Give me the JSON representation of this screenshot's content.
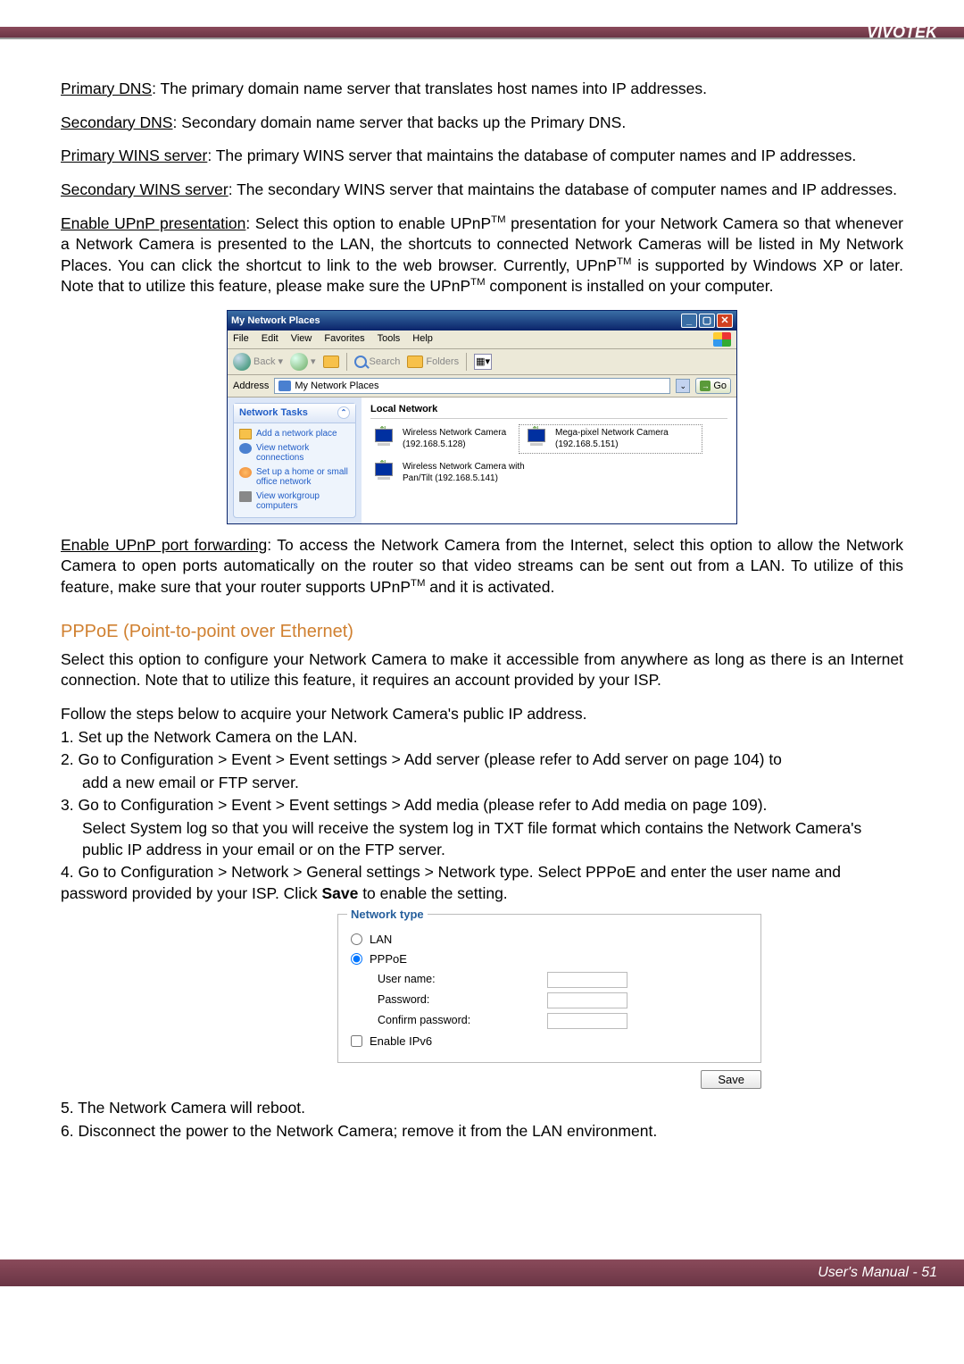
{
  "header": {
    "brand": "VIVOTEK"
  },
  "body": {
    "p1_label": "Primary DNS",
    "p1_text": ": The primary domain name server that translates host names into IP addresses.",
    "p2_label": "Secondary DNS",
    "p2_text": ": Secondary domain name server that backs up the Primary DNS.",
    "p3_label": "Primary WINS server",
    "p3_text": ": The primary WINS server that maintains the database of computer names and IP addresses.",
    "p4_label": "Secondary WINS server",
    "p4_text": ": The secondary WINS server that maintains the database of computer names and IP addresses.",
    "p5_label": "Enable UPnP presentation",
    "p5_t1": ": Select this option to enable UPnP",
    "p5_t2": " presentation for your Network Camera so that whenever a Network Camera is presented to the LAN, the shortcuts to connected Network Cameras will be listed in My Network Places. You can click the shortcut to link to the web browser. Currently, UPnP",
    "p5_t3": " is supported by Windows XP or later. Note that to utilize this feature, please make sure the UPnP",
    "p5_t4": " component is installed on your computer.",
    "p6_label": "Enable UPnP port forwarding",
    "p6_t1": ": To access the Network Camera from the Internet, select this option to allow the Network Camera to open ports automatically on the router so that video streams can be sent out from a LAN. To utilize of this feature, make sure that your router supports UPnP",
    "p6_t2": " and it is activated.",
    "section_title": "PPPoE (Point-to-point over Ethernet)",
    "pppoe_intro": "Select this option to configure your Network Camera to make it accessible from anywhere as long as there is an Internet connection. Note that to utilize this feature, it requires an account provided by your ISP.",
    "steps_intro": "Follow the steps below to acquire your Network Camera's public IP address.",
    "step1": "1. Set up the Network Camera on the LAN.",
    "step2a": "2. Go to Configuration > Event > Event settings > Add server (please refer to Add server on page 104) to",
    "step2b": "add a new email or FTP server.",
    "step3a": "3. Go to Configuration > Event > Event settings > Add media (please refer to Add media on page 109).",
    "step3b": "Select System log so that you will receive the system log in TXT file format which contains the Network Camera's public IP address in your email or on the FTP server.",
    "step4a": "4. Go to Configuration > Network > General settings > Network type. Select PPPoE and enter the user name and password provided by your ISP. Click ",
    "step4b": "Save",
    "step4c": " to enable the setting.",
    "step5": "5. The Network Camera will reboot.",
    "step6": "6. Disconnect the power to the Network Camera; remove it from the LAN environment."
  },
  "xp": {
    "title": "My Network Places",
    "menu": [
      "File",
      "Edit",
      "View",
      "Favorites",
      "Tools",
      "Help"
    ],
    "back": "Back",
    "search": "Search",
    "folders": "Folders",
    "addr_label": "Address",
    "addr_value": "My Network Places",
    "go": "Go",
    "tasks_header": "Network Tasks",
    "tasks": [
      "Add a network place",
      "View network connections",
      "Set up a home or small office network",
      "View workgroup computers"
    ],
    "ln_header": "Local Network",
    "items": [
      "Wireless Network Camera (192.168.5.128)",
      "Mega-pixel Network Camera (192.168.5.151)",
      "Wireless Network Camera with Pan/Tilt (192.168.5.141)"
    ]
  },
  "nt": {
    "legend": "Network type",
    "lan": "LAN",
    "pppoe": "PPPoE",
    "user": "User name:",
    "pass": "Password:",
    "conf": "Confirm password:",
    "ipv6": "Enable IPv6",
    "save": "Save"
  },
  "footer": {
    "text": "User's Manual - 51"
  }
}
